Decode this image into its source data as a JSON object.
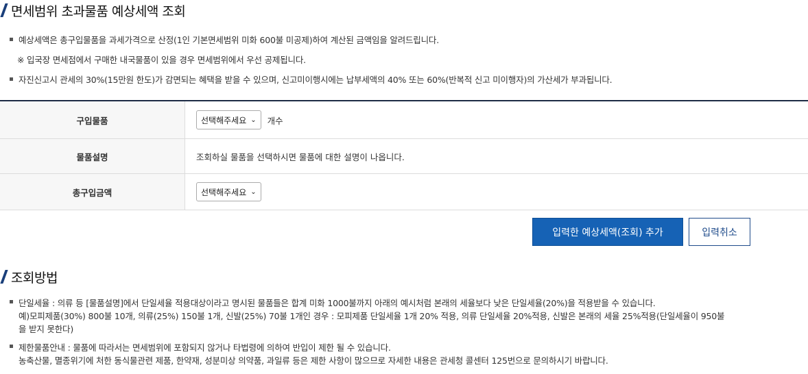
{
  "header": {
    "title": "면세범위 초과물품 예상세액 조회"
  },
  "notes": [
    "예상세액은 총구입물품을 과세가격으로 산정(1인 기본면세범위 미화 600불 미공제)하여 계산된 금액임을 알려드립니다.",
    "※  입국장 면세점에서 구매한 내국물품이 있을 경우 면세범위에서 우선 공제됩니다.",
    "자진신고시 관세의 30%(15만원 한도)가 감면되는 혜택을 받을 수 있으며, 신고미이행시에는 납부세액의 40% 또는 60%(반복적 신고 미이행자)의 가산세가 부과됩니다."
  ],
  "form": {
    "rows": [
      {
        "label": "구입물품",
        "select": "선택해주세요",
        "unit": "개수"
      },
      {
        "label": "물품설명",
        "value": "조회하실 물품을 선택하시면 물품에 대한 설명이 나옵니다."
      },
      {
        "label": "총구입금액",
        "select": "선택해주세요"
      }
    ],
    "buttons": {
      "submit": "입력한 예상세액(조회) 추가",
      "cancel": "입력취소"
    }
  },
  "method": {
    "title": "조회방법",
    "items": [
      {
        "lines": [
          "단일세율 : 의류 등 [물품설명]에서 단일세율 적용대상이라고 명시된 물품들은 합계 미화 1000불까지 아래의 예시처럼 본래의 세율보다 낮은 단일세율(20%)을 적용받을 수 있습니다.",
          "예)모피제품(30%) 800불 10개, 의류(25%) 150불 1개, 신발(25%) 70불 1개인 경우 : 모피제품 단일세율 1개 20% 적용, 의류 단일세율 20%적용, 신발은 본래의 세율 25%적용(단일세율이 950불",
          "을 받지 못한다)"
        ]
      },
      {
        "lines": [
          "제한물품안내 : 물품에 따라서는 면세범위에 포함되지 않거나 타법령에 의하여 반입이 제한 될 수 있습니다.",
          "농축산물, 멸종위기에 처한 동식물관련 제품, 한약재, 성분미상 의약품, 과일류 등은 제한 사항이 많으므로 자세한 내용은 관세청 콜센터 125번으로 문의하시기 바랍니다."
        ]
      }
    ]
  },
  "colors": {
    "primary": "#1662b5",
    "heading_accent": "#1a3f7a",
    "table_top_border": "#1c2a44"
  },
  "icons": {
    "select_arrow": "chevron-down-icon",
    "bullet": "square-bullet-icon"
  }
}
